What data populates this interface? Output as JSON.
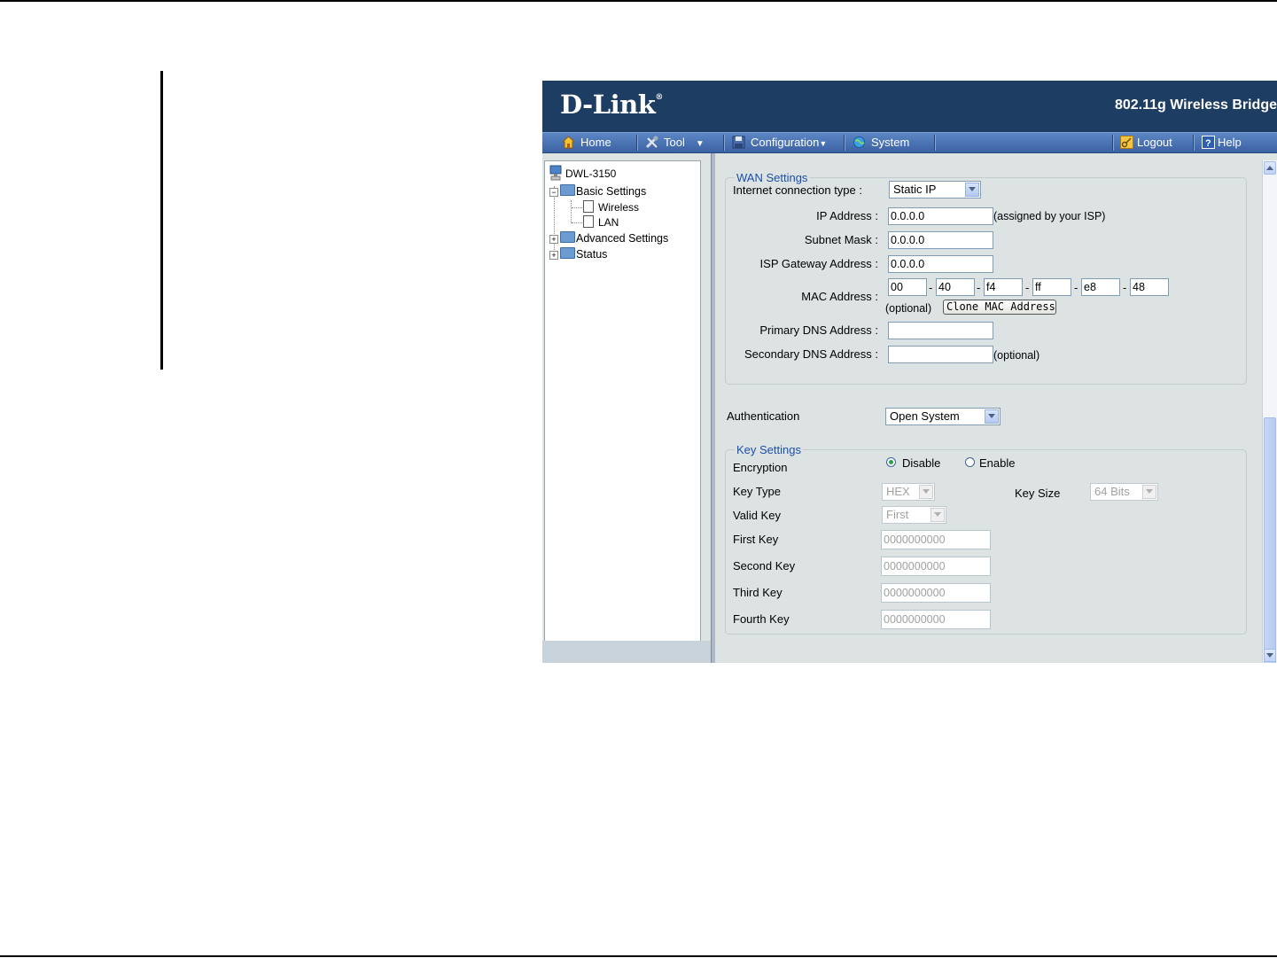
{
  "banner": {
    "logo": "D-Link",
    "product": "802.11g Wireless Bridge"
  },
  "nav": {
    "home": "Home",
    "tool": "Tool",
    "configuration": "Configuration",
    "system": "System",
    "logout": "Logout",
    "help": "Help"
  },
  "tree": {
    "root": "DWL-3150",
    "basic": "Basic Settings",
    "wireless": "Wireless",
    "lan": "LAN",
    "advanced": "Advanced Settings",
    "status": "Status"
  },
  "wan": {
    "legend": "WAN Settings",
    "conn_type_label": "Internet connection type :",
    "conn_type_value": "Static IP",
    "ip_label": "IP Address :",
    "ip_value": "0.0.0.0",
    "ip_note": "(assigned by your ISP)",
    "subnet_label": "Subnet Mask :",
    "subnet_value": "0.0.0.0",
    "gateway_label": "ISP Gateway Address :",
    "gateway_value": "0.0.0.0",
    "mac_label": "MAC Address :",
    "mac": [
      "00",
      "40",
      "f4",
      "ff",
      "e8",
      "48"
    ],
    "mac_sep": "-",
    "mac_optional": "(optional)",
    "clone_button": "Clone MAC Address",
    "dns1_label": "Primary DNS Address :",
    "dns1_value": "",
    "dns2_label": "Secondary DNS Address :",
    "dns2_value": "",
    "dns2_note": "(optional)"
  },
  "auth": {
    "label": "Authentication",
    "value": "Open System"
  },
  "keys": {
    "legend": "Key Settings",
    "encryption_label": "Encryption",
    "disable_label": "Disable",
    "enable_label": "Enable",
    "encryption_selected": "Disable",
    "key_type_label": "Key Type",
    "key_type_value": "HEX",
    "key_size_label": "Key Size",
    "key_size_value": "64 Bits",
    "valid_key_label": "Valid Key",
    "valid_key_value": "First",
    "first_key_label": "First Key",
    "first_key_value": "0000000000",
    "second_key_label": "Second Key",
    "second_key_value": "0000000000",
    "third_key_label": "Third Key",
    "third_key_value": "0000000000",
    "fourth_key_label": "Fourth Key",
    "fourth_key_value": "0000000000"
  },
  "colors": {
    "banner": "#1e3d62",
    "navbar": "#4a73b5",
    "legend": "#1b4fa8",
    "panel": "#dde3e3"
  },
  "icons": {
    "home": "home-icon",
    "tool": "tool-icon",
    "configuration": "floppy-disk-icon",
    "system": "globe-icon",
    "logout": "key-icon",
    "help": "help-icon"
  }
}
